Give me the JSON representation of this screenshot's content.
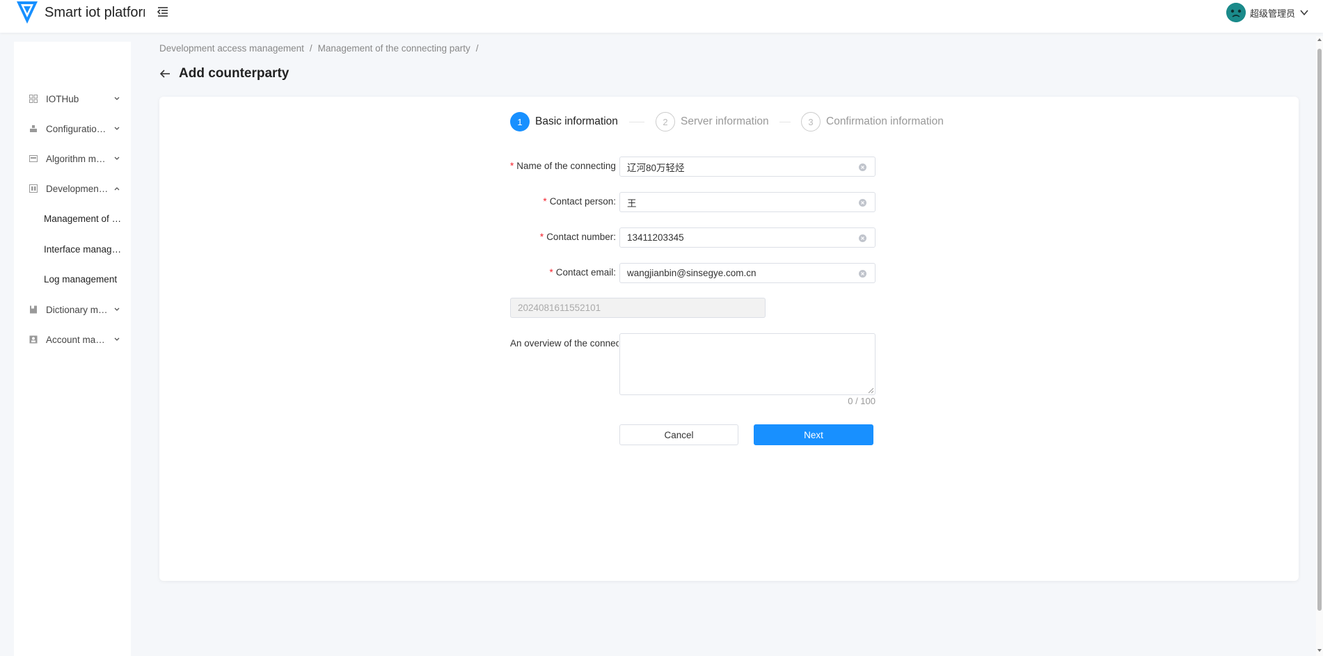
{
  "header": {
    "app_title": "Smart iot platform",
    "user_name": "超级管理员"
  },
  "sidebar": {
    "items": [
      {
        "label": "IOTHub",
        "icon": "grid-icon"
      },
      {
        "label": "Configuration management",
        "icon": "config-icon"
      },
      {
        "label": "Algorithm management",
        "icon": "algorithm-icon"
      },
      {
        "label": "Development access management",
        "icon": "development-icon"
      },
      {
        "label": "Dictionary management",
        "icon": "dictionary-icon"
      },
      {
        "label": "Account management",
        "icon": "account-icon"
      }
    ],
    "subitems": [
      {
        "label": "Management of the connecting party"
      },
      {
        "label": "Interface management"
      },
      {
        "label": "Log management"
      }
    ]
  },
  "breadcrumb": {
    "items": [
      "Development access management",
      "Management of the connecting party"
    ],
    "separator": "/"
  },
  "page": {
    "title": "Add counterparty"
  },
  "steps": [
    {
      "number": "1",
      "title": "Basic information",
      "state": "active"
    },
    {
      "number": "2",
      "title": "Server information",
      "state": "todo"
    },
    {
      "number": "3",
      "title": "Confirmation information",
      "state": "todo"
    }
  ],
  "form": {
    "name": {
      "label": "Name of the connecting party:",
      "value": "辽河80万轻烃"
    },
    "contact_person": {
      "label": "Contact person:",
      "value": "王"
    },
    "contact_number": {
      "label": "Contact number:",
      "value": "13411203345"
    },
    "contact_email": {
      "label": "Contact email:",
      "value": "wangjianbin@sinsegye.com.cn"
    },
    "code": {
      "value": "2024081611552101"
    },
    "overview": {
      "label": "An overview of the connecting party:",
      "value": "",
      "counter": "0 / 100"
    }
  },
  "buttons": {
    "cancel": "Cancel",
    "next": "Next"
  },
  "colors": {
    "primary": "#1890ff",
    "required": "#f5222d"
  }
}
